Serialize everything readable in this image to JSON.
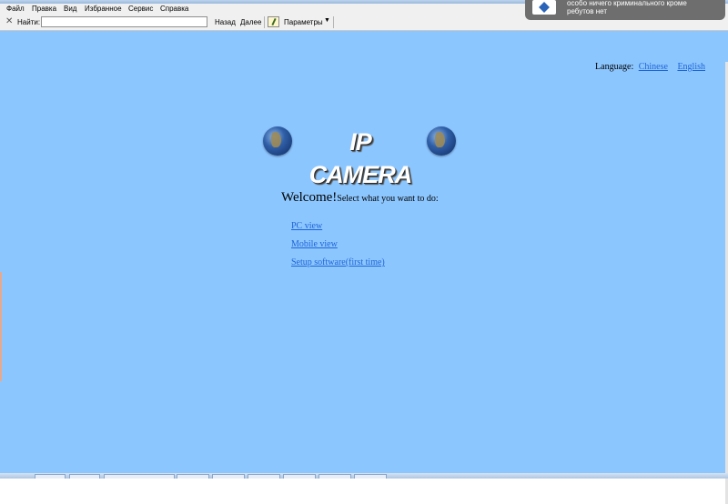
{
  "notification": {
    "line1": "особо ничего криминального кроме",
    "line2": "ребутов нет"
  },
  "menu": [
    "Файл",
    "Правка",
    "Вид",
    "Избранное",
    "Сервис",
    "Справка"
  ],
  "findbar": {
    "label": "Найти:",
    "value": "",
    "back": "Назад",
    "next": "Далее",
    "options": "Параметры"
  },
  "page": {
    "language_label": "Language:",
    "lang_chinese": "Chinese",
    "lang_english": "English",
    "logo_text": "IP CAMERA",
    "welcome": "Welcome!",
    "instruction": "Select what you want to do:",
    "links": [
      "PC view",
      "Mobile view",
      "Setup software(first time)"
    ]
  },
  "colors": {
    "page_background": "#8cc6ff",
    "link": "#1e64d6"
  }
}
